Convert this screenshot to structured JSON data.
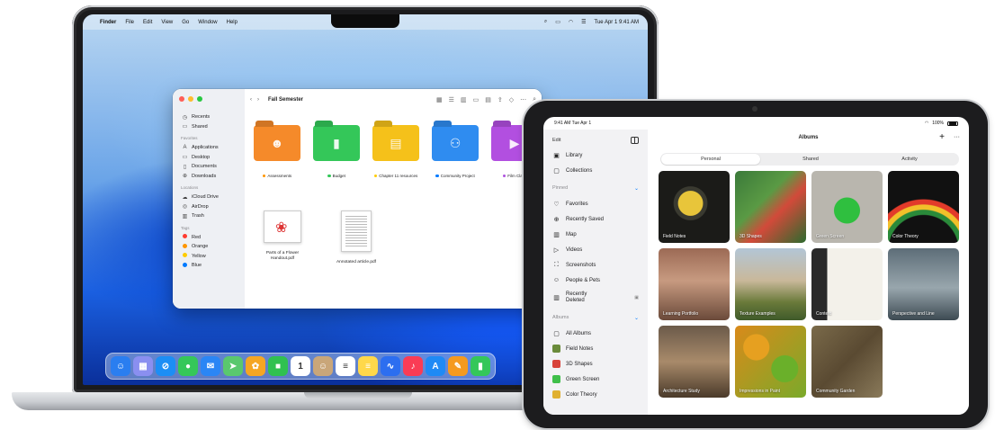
{
  "mac": {
    "menubar": {
      "items": [
        "Finder",
        "File",
        "Edit",
        "View",
        "Go",
        "Window",
        "Help"
      ],
      "datetime": "Tue Apr 1  9:41 AM"
    },
    "finder": {
      "title": "Fall Semester",
      "sidebar": {
        "favorites_top": [
          {
            "icon": "clock-icon",
            "label": "Recents"
          },
          {
            "icon": "shared-folder-icon",
            "label": "Shared"
          }
        ],
        "favorites_header": "Favorites",
        "favorites": [
          {
            "icon": "applications-icon",
            "label": "Applications"
          },
          {
            "icon": "desktop-icon",
            "label": "Desktop"
          },
          {
            "icon": "document-icon",
            "label": "Documents"
          },
          {
            "icon": "download-icon",
            "label": "Downloads"
          }
        ],
        "locations_header": "Locations",
        "locations": [
          {
            "icon": "cloud-icon",
            "label": "iCloud Drive"
          },
          {
            "icon": "airdrop-icon",
            "label": "AirDrop"
          },
          {
            "icon": "trash-icon",
            "label": "Trash"
          }
        ],
        "tags_header": "Tags",
        "tags": [
          {
            "label": "Red",
            "color": "#ff3b30"
          },
          {
            "label": "Orange",
            "color": "#ff9500"
          },
          {
            "label": "Yellow",
            "color": "#ffcc00"
          },
          {
            "label": "Blue",
            "color": "#007aff"
          }
        ]
      },
      "folders": [
        {
          "label": "Assessments",
          "color": "#f58a2a",
          "tag_color": "#ff9500",
          "glyph": "☻"
        },
        {
          "label": "Budget",
          "color": "#34c759",
          "tag_color": "#34c759",
          "glyph": "▮"
        },
        {
          "label": "Chapter 11 resources",
          "color": "#f5c11a",
          "tag_color": "#ffcc00",
          "glyph": "▤"
        },
        {
          "label": "Community Project",
          "color": "#2f8cf0",
          "tag_color": "#007aff",
          "glyph": "⚇"
        },
        {
          "label": "Film Class",
          "color": "#b24fe0",
          "tag_color": "#af52de",
          "glyph": "▶"
        }
      ],
      "files": [
        {
          "label": "Parts of a Flower Handout.pdf"
        },
        {
          "label": "Annotated article.pdf"
        }
      ]
    },
    "dock": [
      {
        "name": "finder",
        "color": "#2a7ef0",
        "glyph": "☺"
      },
      {
        "name": "launchpad",
        "color": "#8a8ff0",
        "glyph": "▦"
      },
      {
        "name": "safari",
        "color": "#1c8ef5",
        "glyph": "⊘"
      },
      {
        "name": "messages",
        "color": "#35c759",
        "glyph": "●"
      },
      {
        "name": "mail",
        "color": "#2a86f5",
        "glyph": "✉"
      },
      {
        "name": "maps",
        "color": "#5ac86e",
        "glyph": "➤"
      },
      {
        "name": "photos",
        "color": "#f5a623",
        "glyph": "✿"
      },
      {
        "name": "facetime",
        "color": "#30c150",
        "glyph": "■"
      },
      {
        "name": "calendar",
        "color": "#ffffff",
        "glyph": "1"
      },
      {
        "name": "contacts",
        "color": "#c9a679",
        "glyph": "☺"
      },
      {
        "name": "reminders",
        "color": "#ffffff",
        "glyph": "≡"
      },
      {
        "name": "notes",
        "color": "#ffd84a",
        "glyph": "≡"
      },
      {
        "name": "freeform",
        "color": "#2c6ef0",
        "glyph": "∿"
      },
      {
        "name": "music",
        "color": "#fa3c55",
        "glyph": "♪"
      },
      {
        "name": "app-store",
        "color": "#1f8af5",
        "glyph": "A"
      },
      {
        "name": "pages",
        "color": "#f59a20",
        "glyph": "✎"
      },
      {
        "name": "numbers",
        "color": "#34c759",
        "glyph": "▮"
      }
    ]
  },
  "ipad": {
    "status": {
      "time": "9:41 AM  Tue Apr 1",
      "battery": "100%"
    },
    "sidebar": {
      "edit_label": "Edit",
      "top": [
        {
          "icon": "photo-library-icon",
          "label": "Library"
        },
        {
          "icon": "collections-icon",
          "label": "Collections"
        }
      ],
      "pinned_header": "Pinned",
      "pinned": [
        {
          "icon": "heart-icon",
          "label": "Favorites",
          "locked": false
        },
        {
          "icon": "recently-saved-icon",
          "label": "Recently Saved",
          "locked": false
        },
        {
          "icon": "map-icon",
          "label": "Map",
          "locked": false
        },
        {
          "icon": "video-icon",
          "label": "Videos",
          "locked": false
        },
        {
          "icon": "screenshot-icon",
          "label": "Screenshots",
          "locked": false
        },
        {
          "icon": "people-icon",
          "label": "People & Pets",
          "locked": false
        },
        {
          "icon": "trash-icon",
          "label": "Recently Deleted",
          "locked": true
        }
      ],
      "albums_header": "Albums",
      "albums": [
        {
          "icon": "albums-icon",
          "label": "All Albums",
          "thumb": ""
        },
        {
          "icon": "",
          "label": "Field Notes",
          "thumb": "#6a8b3a"
        },
        {
          "icon": "",
          "label": "3D Shapes",
          "thumb": "#d8433a"
        },
        {
          "icon": "",
          "label": "Green Screen",
          "thumb": "#3fbf4a"
        },
        {
          "icon": "",
          "label": "Color Theory",
          "thumb": "#e0b030"
        }
      ]
    },
    "main": {
      "title": "Albums",
      "add_label": "+",
      "more_label": "···",
      "tabs": [
        {
          "label": "Personal",
          "active": true
        },
        {
          "label": "Shared",
          "active": false
        },
        {
          "label": "Activity",
          "active": false
        }
      ],
      "albums": [
        {
          "name": "Field Notes",
          "bg": "radial-gradient(circle at 45% 45%, #e8c53a 0 22%, #3a3a30 23% 30%, #1b1b18 31% 100%)"
        },
        {
          "name": "3D Shapes",
          "bg": "linear-gradient(135deg, #3b7a3a 0%, #5a9a44 40%, #d24a3a 60%, #2c6a2e 100%)"
        },
        {
          "name": "Green Screen",
          "bg": "radial-gradient(circle at 50% 55%, #2fbf3f 0 24%, #b9b6ae 25% 100%)"
        },
        {
          "name": "Color Theory",
          "bg": "radial-gradient(circle at 50% 110%, #111 0 40%, #2a8a3a 41% 46%, #f2c02a 47% 52%, #e23a2a 53% 58%, #111 59% 100%)"
        },
        {
          "name": "Learning Portfolio",
          "bg": "linear-gradient(180deg, #9c6a55 0%, #c79a80 45%, #6b4a3a 100%)"
        },
        {
          "name": "Texture Examples",
          "bg": "linear-gradient(180deg, #b3c6d6 0%, #c9b89a 45%, #6a7a3a 75%, #3f5a2a 100%)"
        },
        {
          "name": "Context",
          "bg": "linear-gradient(90deg, #2a2a2a 0 22%, #f3f1ea 22% 100%)"
        },
        {
          "name": "Perspective and Line",
          "bg": "linear-gradient(180deg, #5d6d78 0%, #98a6ad 55%, #3d4a52 100%)"
        },
        {
          "name": "Architecture Study",
          "bg": "linear-gradient(180deg, #6b5a4a 0%, #a88a6a 50%, #4a3a2a 100%)"
        },
        {
          "name": "Impressions in Paint",
          "bg": "radial-gradient(circle at 30% 30%, #e6a020 0 18%, transparent 19%), radial-gradient(circle at 70% 60%, #6ab02a 0 20%, transparent 21%), linear-gradient(135deg, #d98a1a, #7aaa2a)"
        },
        {
          "name": "Community Garden",
          "bg": "linear-gradient(135deg, #7a6a4a 0%, #5a4a32 50%, #8a7a5a 100%)"
        }
      ]
    }
  }
}
